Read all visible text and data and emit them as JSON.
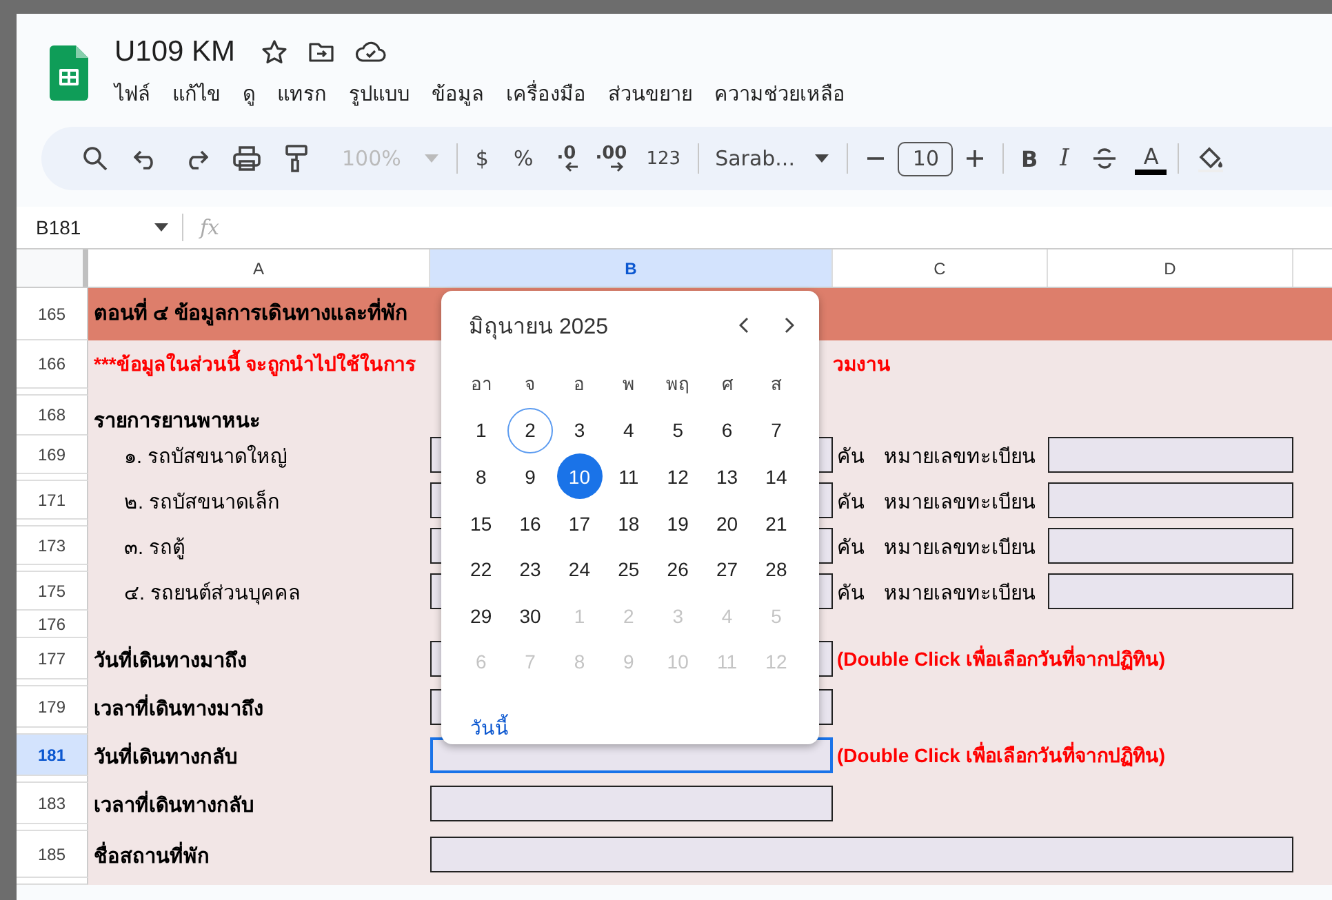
{
  "document": {
    "title": "U109 KM"
  },
  "menu": [
    "ไฟล์",
    "แก้ไข",
    "ดู",
    "แทรก",
    "รูปแบบ",
    "ข้อมูล",
    "เครื่องมือ",
    "ส่วนขยาย",
    "ความช่วยเหลือ"
  ],
  "toolbar": {
    "zoom": {
      "value": "100%",
      "disabled": true
    },
    "currency": "$",
    "percent": "%",
    "decrease_decimals": ".0",
    "increase_decimals": ".00",
    "more_formats": "123",
    "font": "Sarab...",
    "font_size": "10",
    "bold": "B",
    "italic": "I",
    "text_color": "A"
  },
  "formula_bar": {
    "cell_ref": "B181",
    "fx": "fx"
  },
  "columns": [
    {
      "label": "A",
      "selected": false
    },
    {
      "label": "B",
      "selected": true
    },
    {
      "label": "C",
      "selected": false
    },
    {
      "label": "D",
      "selected": false
    }
  ],
  "rows": [
    {
      "kind": "title",
      "number": "165",
      "selected": false,
      "text": "ตอนที่ ๔ ข้อมูลการเดินทางและที่พัก"
    },
    {
      "kind": "note",
      "number": "166",
      "selected": false,
      "text": "***ข้อมูลในส่วนนี้ จะถูกนำไปใช้ในการ",
      "text_right": "วมงาน"
    },
    {
      "kind": "spacer"
    },
    {
      "kind": "heading",
      "number": "168",
      "selected": false,
      "text": "รายการยานพาหนะ"
    },
    {
      "kind": "vehicle",
      "number": "169",
      "selected": false,
      "text": "๑. รถบัสขนาดใหญ่",
      "unit": "คัน",
      "plate_label": "หมายเลขทะเบียน"
    },
    {
      "kind": "spacer"
    },
    {
      "kind": "vehicle",
      "number": "171",
      "selected": false,
      "text": "๒. รถบัสขนาดเล็ก",
      "unit": "คัน",
      "plate_label": "หมายเลขทะเบียน"
    },
    {
      "kind": "spacer"
    },
    {
      "kind": "vehicle",
      "number": "173",
      "selected": false,
      "text": "๓. รถตู้",
      "unit": "คัน",
      "plate_label": "หมายเลขทะเบียน"
    },
    {
      "kind": "spacer"
    },
    {
      "kind": "vehicle",
      "number": "175",
      "selected": false,
      "text": "๔. รถยนต์ส่วนบุคคล",
      "unit": "คัน",
      "plate_label": "หมายเลขทะเบียน"
    },
    {
      "kind": "blank",
      "number": "176",
      "selected": false
    },
    {
      "kind": "field",
      "number": "177",
      "selected": false,
      "text": "วันที่เดินทางมาถึง",
      "hint": "(Double Click เพื่อเลือกวันที่จากปฏิทิน)",
      "active": false
    },
    {
      "kind": "spacer"
    },
    {
      "kind": "field",
      "number": "179",
      "selected": false,
      "text": "เวลาที่เดินทางมาถึง",
      "active": false
    },
    {
      "kind": "spacer"
    },
    {
      "kind": "field",
      "number": "181",
      "selected": true,
      "text": "วันที่เดินทางกลับ",
      "hint": "(Double Click เพื่อเลือกวันที่จากปฏิทิน)",
      "active": true
    },
    {
      "kind": "spacer"
    },
    {
      "kind": "field",
      "number": "183",
      "selected": false,
      "text": "เวลาที่เดินทางกลับ",
      "active": false
    },
    {
      "kind": "spacer"
    },
    {
      "kind": "wide_field",
      "number": "185",
      "selected": false,
      "text": "ชื่อสถานที่พัก"
    },
    {
      "kind": "spacer"
    }
  ],
  "calendar": {
    "month": "มิถุนายน 2025",
    "weekdays": [
      "อา",
      "จ",
      "อ",
      "พ",
      "พฤ",
      "ศ",
      "ส"
    ],
    "days": [
      {
        "label": "1",
        "in_month": true,
        "today": false,
        "selected": false
      },
      {
        "label": "2",
        "in_month": true,
        "today": true,
        "selected": false
      },
      {
        "label": "3",
        "in_month": true,
        "today": false,
        "selected": false
      },
      {
        "label": "4",
        "in_month": true,
        "today": false,
        "selected": false
      },
      {
        "label": "5",
        "in_month": true,
        "today": false,
        "selected": false
      },
      {
        "label": "6",
        "in_month": true,
        "today": false,
        "selected": false
      },
      {
        "label": "7",
        "in_month": true,
        "today": false,
        "selected": false
      },
      {
        "label": "8",
        "in_month": true,
        "today": false,
        "selected": false
      },
      {
        "label": "9",
        "in_month": true,
        "today": false,
        "selected": false
      },
      {
        "label": "10",
        "in_month": true,
        "today": false,
        "selected": true
      },
      {
        "label": "11",
        "in_month": true,
        "today": false,
        "selected": false
      },
      {
        "label": "12",
        "in_month": true,
        "today": false,
        "selected": false
      },
      {
        "label": "13",
        "in_month": true,
        "today": false,
        "selected": false
      },
      {
        "label": "14",
        "in_month": true,
        "today": false,
        "selected": false
      },
      {
        "label": "15",
        "in_month": true,
        "today": false,
        "selected": false
      },
      {
        "label": "16",
        "in_month": true,
        "today": false,
        "selected": false
      },
      {
        "label": "17",
        "in_month": true,
        "today": false,
        "selected": false
      },
      {
        "label": "18",
        "in_month": true,
        "today": false,
        "selected": false
      },
      {
        "label": "19",
        "in_month": true,
        "today": false,
        "selected": false
      },
      {
        "label": "20",
        "in_month": true,
        "today": false,
        "selected": false
      },
      {
        "label": "21",
        "in_month": true,
        "today": false,
        "selected": false
      },
      {
        "label": "22",
        "in_month": true,
        "today": false,
        "selected": false
      },
      {
        "label": "23",
        "in_month": true,
        "today": false,
        "selected": false
      },
      {
        "label": "24",
        "in_month": true,
        "today": false,
        "selected": false
      },
      {
        "label": "25",
        "in_month": true,
        "today": false,
        "selected": false
      },
      {
        "label": "26",
        "in_month": true,
        "today": false,
        "selected": false
      },
      {
        "label": "27",
        "in_month": true,
        "today": false,
        "selected": false
      },
      {
        "label": "28",
        "in_month": true,
        "today": false,
        "selected": false
      },
      {
        "label": "29",
        "in_month": true,
        "today": false,
        "selected": false
      },
      {
        "label": "30",
        "in_month": true,
        "today": false,
        "selected": false
      },
      {
        "label": "1",
        "in_month": false,
        "today": false,
        "selected": false
      },
      {
        "label": "2",
        "in_month": false,
        "today": false,
        "selected": false
      },
      {
        "label": "3",
        "in_month": false,
        "today": false,
        "selected": false
      },
      {
        "label": "4",
        "in_month": false,
        "today": false,
        "selected": false
      },
      {
        "label": "5",
        "in_month": false,
        "today": false,
        "selected": false
      },
      {
        "label": "6",
        "in_month": false,
        "today": false,
        "selected": false
      },
      {
        "label": "7",
        "in_month": false,
        "today": false,
        "selected": false
      },
      {
        "label": "8",
        "in_month": false,
        "today": false,
        "selected": false
      },
      {
        "label": "9",
        "in_month": false,
        "today": false,
        "selected": false
      },
      {
        "label": "10",
        "in_month": false,
        "today": false,
        "selected": false
      },
      {
        "label": "11",
        "in_month": false,
        "today": false,
        "selected": false
      },
      {
        "label": "12",
        "in_month": false,
        "today": false,
        "selected": false
      }
    ],
    "today_link": "วันนี้"
  }
}
